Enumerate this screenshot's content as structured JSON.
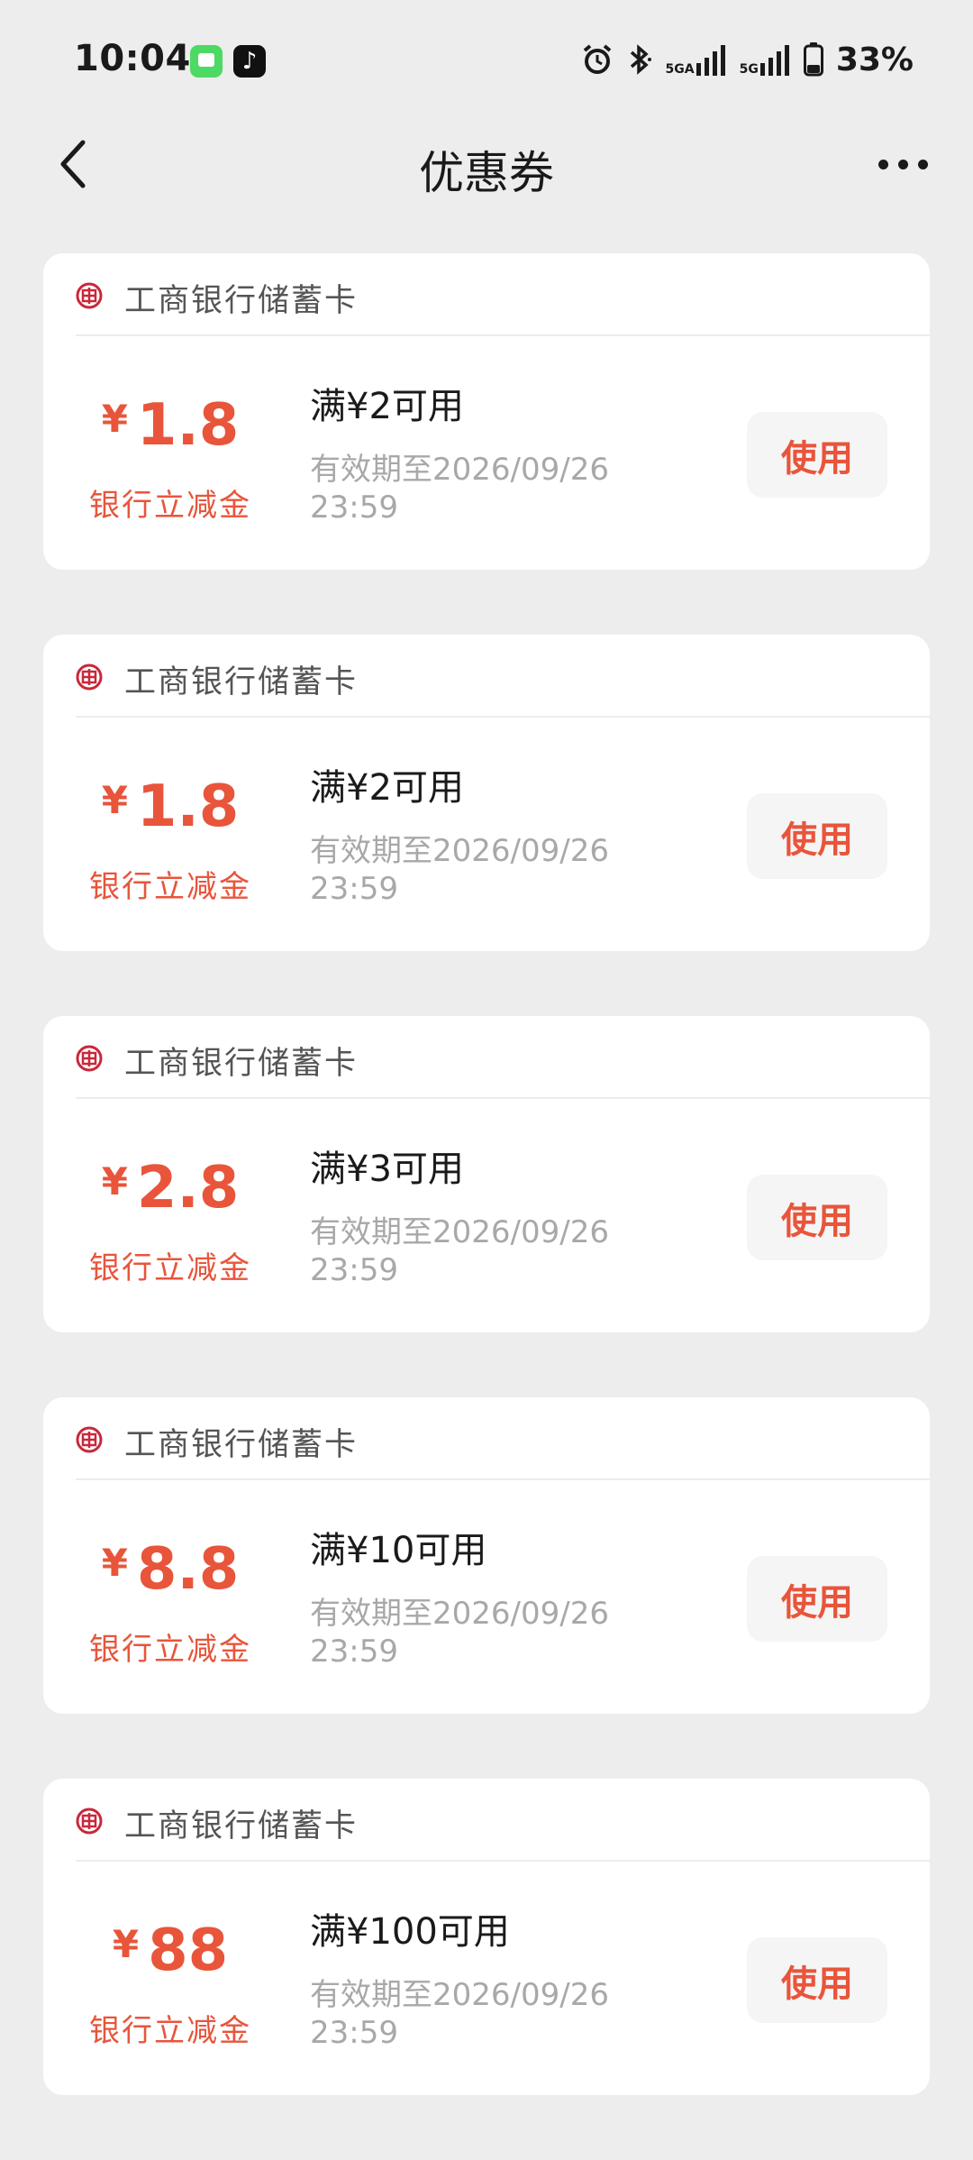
{
  "status_bar": {
    "time": "10:04",
    "network_1": "5GA",
    "network_2": "5G",
    "battery": "33%"
  },
  "nav": {
    "title": "优惠券"
  },
  "colors": {
    "accent": "#e8553b",
    "background": "#ededed",
    "card": "#ffffff",
    "bank_logo": "#c8283c"
  },
  "coupons": [
    {
      "bank": "工商银行储蓄卡",
      "currency": "¥",
      "amount": "1.8",
      "amount_desc": "银行立减金",
      "condition": "满¥2可用",
      "expiry": "有效期至2026/09/26 23:59",
      "button": "使用"
    },
    {
      "bank": "工商银行储蓄卡",
      "currency": "¥",
      "amount": "1.8",
      "amount_desc": "银行立减金",
      "condition": "满¥2可用",
      "expiry": "有效期至2026/09/26 23:59",
      "button": "使用"
    },
    {
      "bank": "工商银行储蓄卡",
      "currency": "¥",
      "amount": "2.8",
      "amount_desc": "银行立减金",
      "condition": "满¥3可用",
      "expiry": "有效期至2026/09/26 23:59",
      "button": "使用"
    },
    {
      "bank": "工商银行储蓄卡",
      "currency": "¥",
      "amount": "8.8",
      "amount_desc": "银行立减金",
      "condition": "满¥10可用",
      "expiry": "有效期至2026/09/26 23:59",
      "button": "使用"
    },
    {
      "bank": "工商银行储蓄卡",
      "currency": "¥",
      "amount": "88",
      "amount_desc": "银行立减金",
      "condition": "满¥100可用",
      "expiry": "有效期至2026/09/26 23:59",
      "button": "使用"
    }
  ]
}
